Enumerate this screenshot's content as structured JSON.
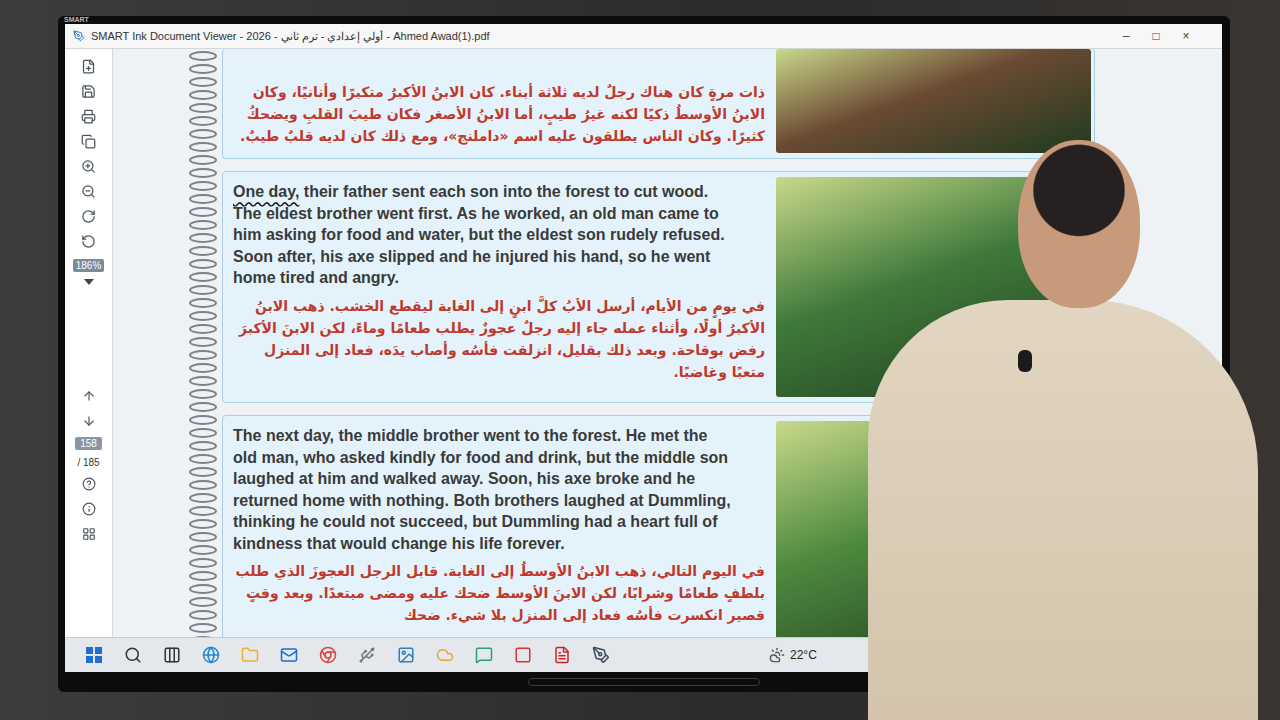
{
  "bezel": {
    "brand": "SMART"
  },
  "window": {
    "title": "SMART Ink Document Viewer - 2026 - أولي إعدادي - ترم ثاني - Ahmed Awad(1).pdf",
    "controls": [
      "–",
      "□",
      "×"
    ]
  },
  "toolbar": {
    "zoom": "186%",
    "page": "158",
    "total": "/ 185"
  },
  "cards": [
    {
      "cut": true,
      "lead": "",
      "english": "",
      "arabic": "ذات مرةٍ كان هناك رجلٌ لديه ثلاثة أبناء. كان الابنُ الأكبرُ متكبرًا وأنانيًا، وكان الابنُ الأوسطُ ذكيًا لكنه غيرُ طيبٍ، أما الابنُ الأصغر فكان طيبَ القلبِ ويضحكُ كثيرًا. وكان الناس يطلقون عليه اسم «داملنج»، ومع ذلك كان لديه قلبٌ طيبٌ.",
      "picture": "#6b4a33"
    },
    {
      "cut": false,
      "lead": "One day,",
      "english": " their father sent each son into the forest to cut wood. The eldest brother went first. As he worked, an old man came to him asking for food and water, but the eldest son rudely refused. Soon after, his axe slipped and he injured his hand, so he went home tired and angry.",
      "arabic": "في يومٍ من الأيام، أرسل الأبُ كلَّ ابنٍ إلى الغابة ليقطع الخشب. ذهب الابنُ الأكبرُ أولًا، وأثناء عمله جاء إليه رجلٌ عجوزٌ يطلب طعامًا وماءً، لكن الابنَ الأكبرَ رفض بوقاحة. وبعد ذلك بقليل، انزلقت فأسُه وأصاب يدَه، فعاد إلى المنزل متعبًا وغاضبًا.",
      "picture": "#3f7a3a"
    },
    {
      "cut": false,
      "lead": "",
      "english": "The next day, the middle brother went to the forest. He met the old man, who asked kindly for food and drink, but the middle son laughed at him and walked away. Soon, his axe broke and he returned home with nothing. Both brothers laughed at Dummling, thinking he could not succeed, but Dummling had a heart full of kindness that would change his life forever.",
      "arabic": "في اليوم التالي، ذهب الابنُ الأوسطُ إلى الغابة. قابل الرجل العجوزَ الذي طلب بلطفٍ طعامًا وشرابًا، لكن الابنَ الأوسط ضحك عليه ومضى مبتعدًا. وبعد وقتٍ قصير انكسرت فأسُه فعاد إلى المنزل بلا شيء. ضحك",
      "picture": "#4d8a3e"
    }
  ],
  "taskbar": {
    "weather": "22°C"
  }
}
